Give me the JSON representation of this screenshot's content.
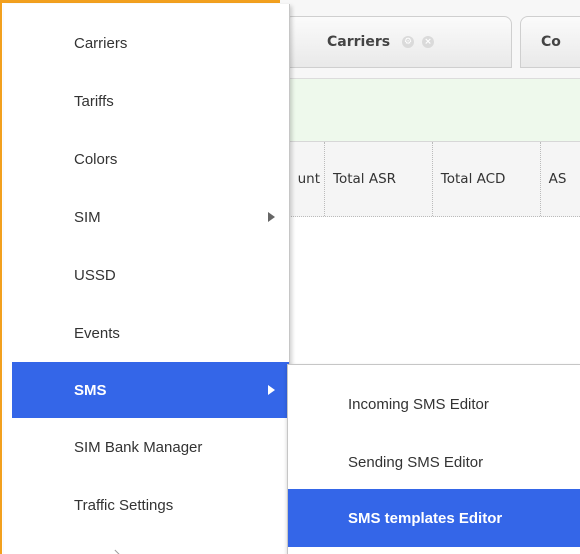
{
  "menu": {
    "items": [
      {
        "label": "Carriers",
        "has_submenu": false
      },
      {
        "label": "Tariffs",
        "has_submenu": false
      },
      {
        "label": "Colors",
        "has_submenu": false
      },
      {
        "label": "SIM",
        "has_submenu": true
      },
      {
        "label": "USSD",
        "has_submenu": false
      },
      {
        "label": "Events",
        "has_submenu": false
      },
      {
        "label": "SMS",
        "has_submenu": true,
        "active": true
      },
      {
        "label": "SIM Bank Manager",
        "has_submenu": false
      },
      {
        "label": "Traffic Settings",
        "has_submenu": false
      }
    ]
  },
  "submenu": {
    "items": [
      {
        "label": "Incoming SMS Editor"
      },
      {
        "label": "Sending SMS Editor"
      },
      {
        "label": "SMS templates Editor",
        "active": true
      }
    ]
  },
  "background": {
    "tabs": [
      {
        "label": "Carriers"
      },
      {
        "label": "Co"
      }
    ],
    "table": {
      "columns": [
        "unt",
        "Total ASR",
        "Total ACD",
        "AS"
      ]
    }
  },
  "colors": {
    "frame": "#f2a01e",
    "active": "#3466e8",
    "filter_bar": "#eef9ec"
  },
  "icons": {
    "submenu_arrow": "chevron-right-icon",
    "tab_settings": "gear-icon",
    "tab_close": "close-icon"
  }
}
